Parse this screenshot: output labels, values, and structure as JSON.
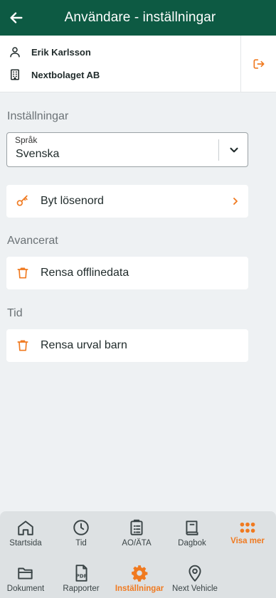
{
  "header": {
    "title": "Användare - inställningar"
  },
  "user": {
    "name": "Erik Karlsson",
    "company": "Nextbolaget AB"
  },
  "sections": {
    "settings": "Inställningar",
    "advanced": "Avancerat",
    "time": "Tid"
  },
  "language": {
    "label": "Språk",
    "value": "Svenska"
  },
  "items": {
    "password": "Byt lösenord",
    "clear_offline": "Rensa offlinedata",
    "clear_children": "Rensa urval barn"
  },
  "nav": {
    "home": "Startsida",
    "time": "Tid",
    "ao": "AO/ÄTA",
    "diary": "Dagbok",
    "more": "Visa mer",
    "documents": "Dokument",
    "reports": "Rapporter",
    "settings": "Inställningar",
    "vehicle": "Next Vehicle"
  },
  "colors": {
    "header": "#0d5a43",
    "accent": "#f07a20",
    "background": "#eef1f3"
  },
  "icons": [
    "arrow-left-icon",
    "user-icon",
    "building-icon",
    "logout-icon",
    "chevron-down-icon",
    "key-icon",
    "chevron-right-icon",
    "trash-icon",
    "home-icon",
    "clock-icon",
    "clipboard-icon",
    "book-icon",
    "grid-dots-icon",
    "folder-icon",
    "pdf-icon",
    "gear-icon",
    "map-pin-icon"
  ]
}
